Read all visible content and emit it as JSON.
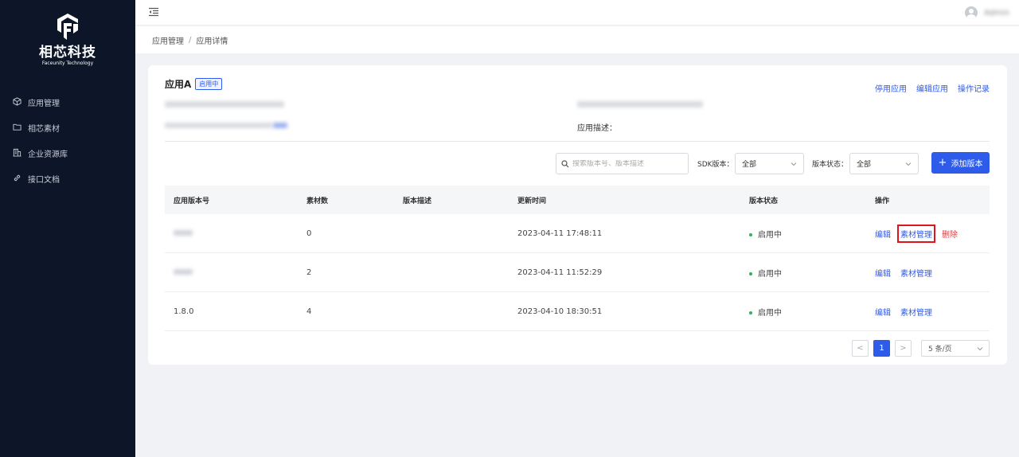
{
  "brand": {
    "name": "相芯科技",
    "subtitle": "Faceunity Technology"
  },
  "sidebar": {
    "items": [
      {
        "label": "应用管理",
        "icon": "cube-icon"
      },
      {
        "label": "相芯素材",
        "icon": "folder-icon"
      },
      {
        "label": "企业资源库",
        "icon": "building-icon"
      },
      {
        "label": "接口文档",
        "icon": "link-icon"
      }
    ]
  },
  "header": {
    "username": "Admin"
  },
  "breadcrumb": {
    "parent": "应用管理",
    "separator": "/",
    "current": "应用详情"
  },
  "app": {
    "name": "应用A",
    "status_tag": "启用中",
    "actions": {
      "disable": "停用应用",
      "edit": "编辑应用",
      "log": "操作记录"
    },
    "info_left_1": "",
    "info_left_2": "",
    "info_right_1": "",
    "description_label": "应用描述："
  },
  "filters": {
    "search_placeholder": "搜索版本号、版本描述",
    "sdk_label": "SDK版本：",
    "sdk_value": "全部",
    "status_label": "版本状态：",
    "status_value": "全部",
    "add_button": "添加版本"
  },
  "table": {
    "headers": [
      "应用版本号",
      "素材数",
      "版本描述",
      "更新时间",
      "版本状态",
      "操作"
    ],
    "rows": [
      {
        "version": "",
        "count": "0",
        "desc": "",
        "updated": "2023-04-11 17:48:11",
        "status": "启用中",
        "edit": "编辑",
        "manage": "素材管理",
        "delete": "删除"
      },
      {
        "version": "",
        "count": "2",
        "desc": "",
        "updated": "2023-04-11 11:52:29",
        "status": "启用中",
        "edit": "编辑",
        "manage": "素材管理",
        "delete": ""
      },
      {
        "version": "1.8.0",
        "count": "4",
        "desc": "",
        "updated": "2023-04-10 18:30:51",
        "status": "启用中",
        "edit": "编辑",
        "manage": "素材管理",
        "delete": ""
      }
    ]
  },
  "pagination": {
    "prev": "<",
    "current_page": "1",
    "next": ">",
    "page_size": "5 条/页"
  },
  "colors": {
    "accent": "#2f5bea",
    "sidebar_bg": "#0d1628",
    "danger": "#e5383b",
    "status_green": "#2db25a",
    "highlight_box": "#e0141a"
  }
}
